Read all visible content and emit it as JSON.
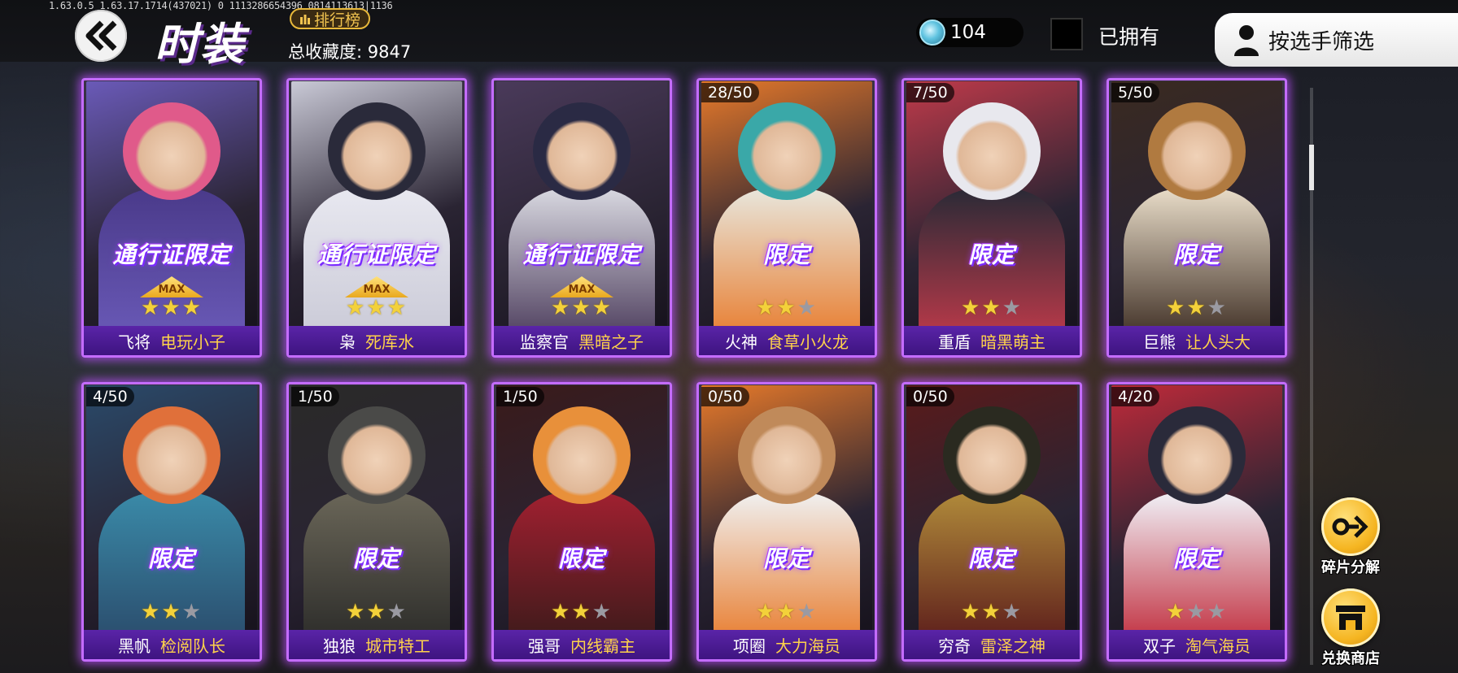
{
  "version_text": "1.63.0.5  1.63.17.1714(437021)  0  1113286654396  0814113613|1136",
  "header": {
    "title": "时装",
    "rank_label": "排行榜",
    "collection_label": "总收藏度: 9847",
    "currency_value": "104",
    "owned_label": "已拥有",
    "filter_label": "按选手筛选"
  },
  "cards": [
    {
      "hero": "飞将",
      "skin": "电玩小子",
      "tag": "通行证限定",
      "max": "MAX",
      "stars": 3,
      "progress": "",
      "colors": [
        "#e05a8a",
        "#4a3a8a",
        "#6a5ab8"
      ]
    },
    {
      "hero": "枭",
      "skin": "死库水",
      "tag": "通行证限定",
      "max": "MAX",
      "stars": 3,
      "progress": "",
      "colors": [
        "#2a2a3a",
        "#e8e8f0",
        "#c9c9d6"
      ]
    },
    {
      "hero": "监察官",
      "skin": "黑暗之子",
      "tag": "通行证限定",
      "max": "MAX",
      "stars": 3,
      "progress": "",
      "colors": [
        "#2a2a44",
        "#d8d8e0",
        "#4a3a5a"
      ]
    },
    {
      "hero": "火神",
      "skin": "食草小火龙",
      "tag": "限定",
      "max": "",
      "stars": 2,
      "progress": "28/50",
      "colors": [
        "#3aa8a8",
        "#e8e6dc",
        "#e87a2a"
      ]
    },
    {
      "hero": "重盾",
      "skin": "暗黑萌主",
      "tag": "限定",
      "max": "",
      "stars": 2,
      "progress": "7/50",
      "colors": [
        "#e8e8ee",
        "#2a2a36",
        "#c03a4a"
      ]
    },
    {
      "hero": "巨熊",
      "skin": "让人头大",
      "tag": "限定",
      "max": "",
      "stars": 2,
      "progress": "5/50",
      "colors": [
        "#b07a40",
        "#e8dcc8",
        "#3a2a20"
      ]
    },
    {
      "hero": "黑帆",
      "skin": "检阅队长",
      "tag": "限定",
      "max": "",
      "stars": 2,
      "progress": "4/50",
      "colors": [
        "#e0703a",
        "#3a8aa8",
        "#2a4a6a"
      ]
    },
    {
      "hero": "独狼",
      "skin": "城市特工",
      "tag": "限定",
      "max": "",
      "stars": 2,
      "progress": "1/50",
      "colors": [
        "#4a4a48",
        "#6a6658",
        "#2a2a28"
      ]
    },
    {
      "hero": "强哥",
      "skin": "内线霸主",
      "tag": "限定",
      "max": "",
      "stars": 2,
      "progress": "1/50",
      "colors": [
        "#e8903a",
        "#a02030",
        "#3a1a1a"
      ]
    },
    {
      "hero": "项圈",
      "skin": "大力海员",
      "tag": "限定",
      "max": "",
      "stars": 2,
      "progress": "0/50",
      "colors": [
        "#c08a5a",
        "#f0f0f0",
        "#e87a2a"
      ]
    },
    {
      "hero": "穷奇",
      "skin": "雷泽之神",
      "tag": "限定",
      "max": "",
      "stars": 2,
      "progress": "0/50",
      "colors": [
        "#2a2a20",
        "#b08a3a",
        "#5a1a1a"
      ]
    },
    {
      "hero": "双子",
      "skin": "淘气海员",
      "tag": "限定",
      "max": "",
      "stars": 1,
      "progress": "4/20",
      "colors": [
        "#2a2a3a",
        "#f0f0f6",
        "#c02a3a"
      ]
    }
  ],
  "side": {
    "decompose_label": "碎片分解",
    "shop_label": "兑换商店"
  }
}
